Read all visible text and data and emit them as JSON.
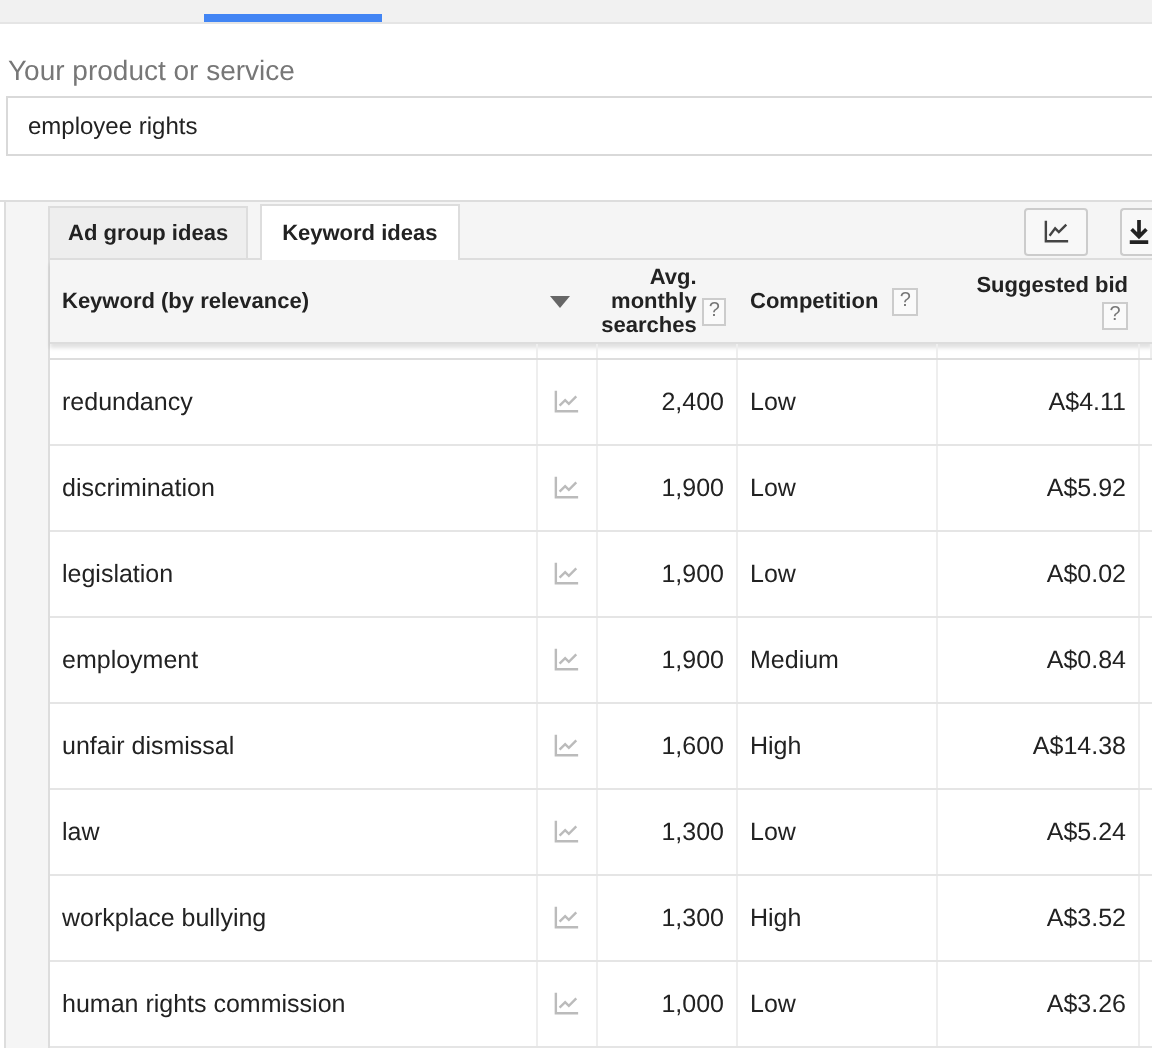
{
  "search": {
    "label": "Your product or service",
    "value": "employee rights"
  },
  "tabs": [
    {
      "label": "Ad group ideas",
      "selected": false
    },
    {
      "label": "Keyword ideas",
      "selected": true
    }
  ],
  "table": {
    "columns": [
      {
        "label": "Keyword (by relevance)",
        "sorted": false
      },
      {
        "label": "Avg. monthly searches",
        "help": "?",
        "sorted": true
      },
      {
        "label": "Competition",
        "help": "?",
        "sorted": false
      },
      {
        "label": "Suggested bid",
        "help": "?",
        "sorted": false
      }
    ],
    "rows": [
      {
        "keyword": "redundancy",
        "searches": "2,400",
        "competition": "Low",
        "bid": "A$4.11"
      },
      {
        "keyword": "discrimination",
        "searches": "1,900",
        "competition": "Low",
        "bid": "A$5.92"
      },
      {
        "keyword": "legislation",
        "searches": "1,900",
        "competition": "Low",
        "bid": "A$0.02"
      },
      {
        "keyword": "employment",
        "searches": "1,900",
        "competition": "Medium",
        "bid": "A$0.84"
      },
      {
        "keyword": "unfair dismissal",
        "searches": "1,600",
        "competition": "High",
        "bid": "A$14.38"
      },
      {
        "keyword": "law",
        "searches": "1,300",
        "competition": "Low",
        "bid": "A$5.24"
      },
      {
        "keyword": "workplace bullying",
        "searches": "1,300",
        "competition": "High",
        "bid": "A$3.52"
      },
      {
        "keyword": "human rights commission",
        "searches": "1,000",
        "competition": "Low",
        "bid": "A$3.26"
      }
    ]
  }
}
